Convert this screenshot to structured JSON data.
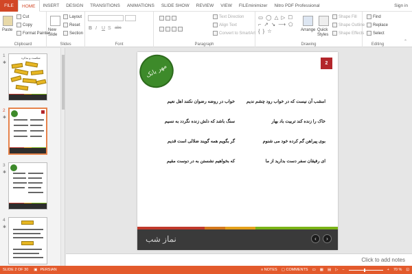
{
  "tabs": [
    "FILE",
    "HOME",
    "INSERT",
    "DESIGN",
    "TRANSITIONS",
    "ANIMATIONS",
    "SLIDE SHOW",
    "REVIEW",
    "VIEW",
    "FILEminimizer",
    "Nitro PDF Professional"
  ],
  "account": {
    "signin": "Sign in"
  },
  "ribbon": {
    "clipboard": {
      "paste": "Paste",
      "cut": "Cut",
      "copy": "Copy",
      "format_painter": "Format Painter",
      "label": "Clipboard"
    },
    "slides": {
      "new_slide": "New Slide",
      "layout": "Layout",
      "reset": "Reset",
      "section": "Section",
      "label": "Slides"
    },
    "font": {
      "label": "Font",
      "bold": "B",
      "italic": "I",
      "underline": "U",
      "shadow": "S",
      "strike": "abc"
    },
    "paragraph": {
      "label": "Paragraph",
      "text_direction": "Text Direction",
      "align_text": "Align Text",
      "convert_smartart": "Convert to SmartArt"
    },
    "drawing": {
      "label": "Drawing",
      "arrange": "Arrange",
      "quick_styles": "Quick Styles",
      "shape_fill": "Shape Fill",
      "shape_outline": "Shape Outline",
      "shape_effects": "Shape Effects",
      "shapes_glyphs": "▭ ◯ △ ▷ ☐ ⌐ ↗ ↘ ⟶ ⬠ { } ☆"
    },
    "editing": {
      "label": "Editing",
      "find": "Find",
      "replace": "Replace",
      "select": "Select"
    }
  },
  "thumbnails": [
    {
      "num": "1",
      "star": "✱",
      "title": "شکست و مذکره"
    },
    {
      "num": "2",
      "star": "✱"
    },
    {
      "num": "3",
      "star": "✱"
    },
    {
      "num": "4",
      "star": "✱"
    }
  ],
  "slide": {
    "number": "2",
    "logo_text": "مهر بانک",
    "verses_right": [
      "امشب آن نیست که در خواب رود چشم ندیم",
      "خاک را زنده کند تربیت باد بهار",
      "بوی پیراهن گم کرده خود می شنوم",
      "ای رفیقان سفر دست بدارید از ما"
    ],
    "verses_left": [
      "خواب در روضه رضوان نکنند اهل نعیم",
      "سنگ باشد که دلش زنده نگردد به نسیم",
      "گر بگویم همه گویند ضلالی است قدیم",
      "که بخواهیم نشستن به در دوست مقیم"
    ],
    "footer_title": "نماز شب",
    "prev": "‹",
    "next": "›",
    "stripe_colors": [
      "#c0392b",
      "#d4781c",
      "#e4a11b",
      "#7ab317"
    ]
  },
  "notes": {
    "placeholder": "Click to add notes"
  },
  "status": {
    "slide_info": "SLIDE 2 OF 30",
    "language": "PERSIAN",
    "notes": "NOTES",
    "comments": "COMMENTS",
    "zoom": "70 %",
    "zoom_minus": "−",
    "zoom_plus": "+"
  },
  "colors": {
    "accent": "#d24726",
    "status_bar": "#e35a2c"
  }
}
